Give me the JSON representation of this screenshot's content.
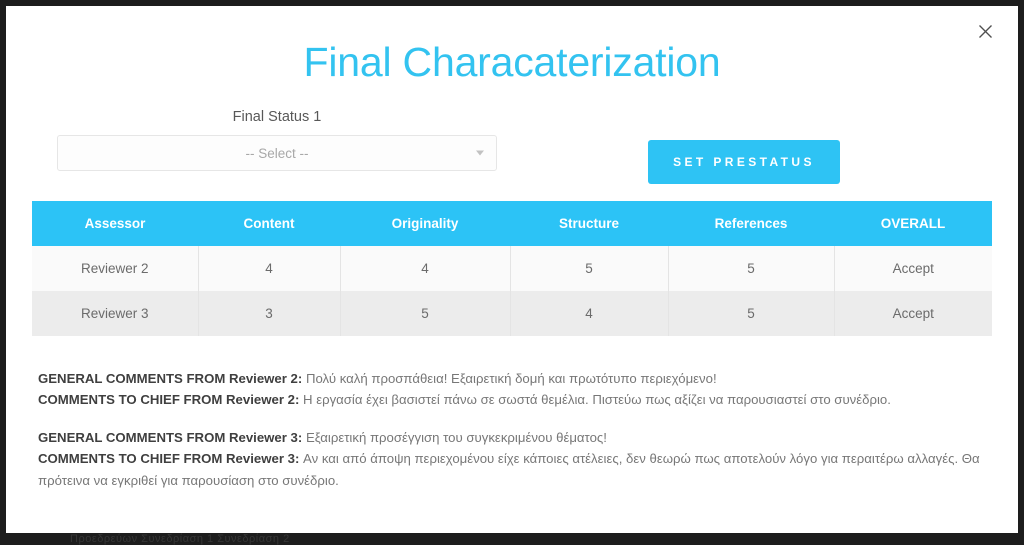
{
  "backdrop": {
    "behind_page_text": "Προεδρεύων                    Συνεδρίαση 1 Συνεδρίαση 2"
  },
  "modal": {
    "close_icon_label": "close-icon",
    "title": "Final Characaterization",
    "form": {
      "status_label": "Final Status 1",
      "status_selected": "-- Select --",
      "status_placeholder": "-- Select --",
      "caret_icon": "chevron-down-icon",
      "set_prestatus_label": "SET PRESTATUS"
    },
    "table": {
      "columns": [
        "Assessor",
        "Content",
        "Originality",
        "Structure",
        "References",
        "OVERALL"
      ],
      "rows": [
        {
          "assessor": "Reviewer 2",
          "content": "4",
          "originality": "4",
          "structure": "5",
          "references": "5",
          "overall": "Accept"
        },
        {
          "assessor": "Reviewer 3",
          "content": "3",
          "originality": "5",
          "structure": "4",
          "references": "5",
          "overall": "Accept"
        }
      ]
    },
    "comments": [
      {
        "general_label": "GENERAL COMMENTS FROM Reviewer 2:",
        "general_text": " Πολύ καλή προσπάθεια! Εξαιρετική δομή και πρωτότυπο περιεχόμενο!",
        "chief_label": "COMMENTS TO CHIEF FROM Reviewer 2:",
        "chief_text": " Η εργασία έχει βασιστεί πάνω σε σωστά θεμέλια. Πιστεύω πως αξίζει να παρουσιαστεί στο συνέδριο."
      },
      {
        "general_label": "GENERAL COMMENTS FROM Reviewer 3:",
        "general_text": " Εξαιρετική προσέγγιση του συγκεκριμένου θέματος!",
        "chief_label": "COMMENTS TO CHIEF FROM Reviewer 3:",
        "chief_text": " Αν και από άποψη περιεχομένου είχε κάποιες ατέλειες, δεν θεωρώ πως αποτελούν λόγο για περαιτέρω αλλαγές. Θα πρότεινα να εγκριθεί για παρουσίαση στο συνέδριο."
      }
    ]
  },
  "colors": {
    "accent_blue": "#2cc3f6",
    "title_blue": "#33c3f0",
    "row_even": "#fafafa",
    "row_odd": "#ececec",
    "backdrop": "#1d1d1d"
  }
}
